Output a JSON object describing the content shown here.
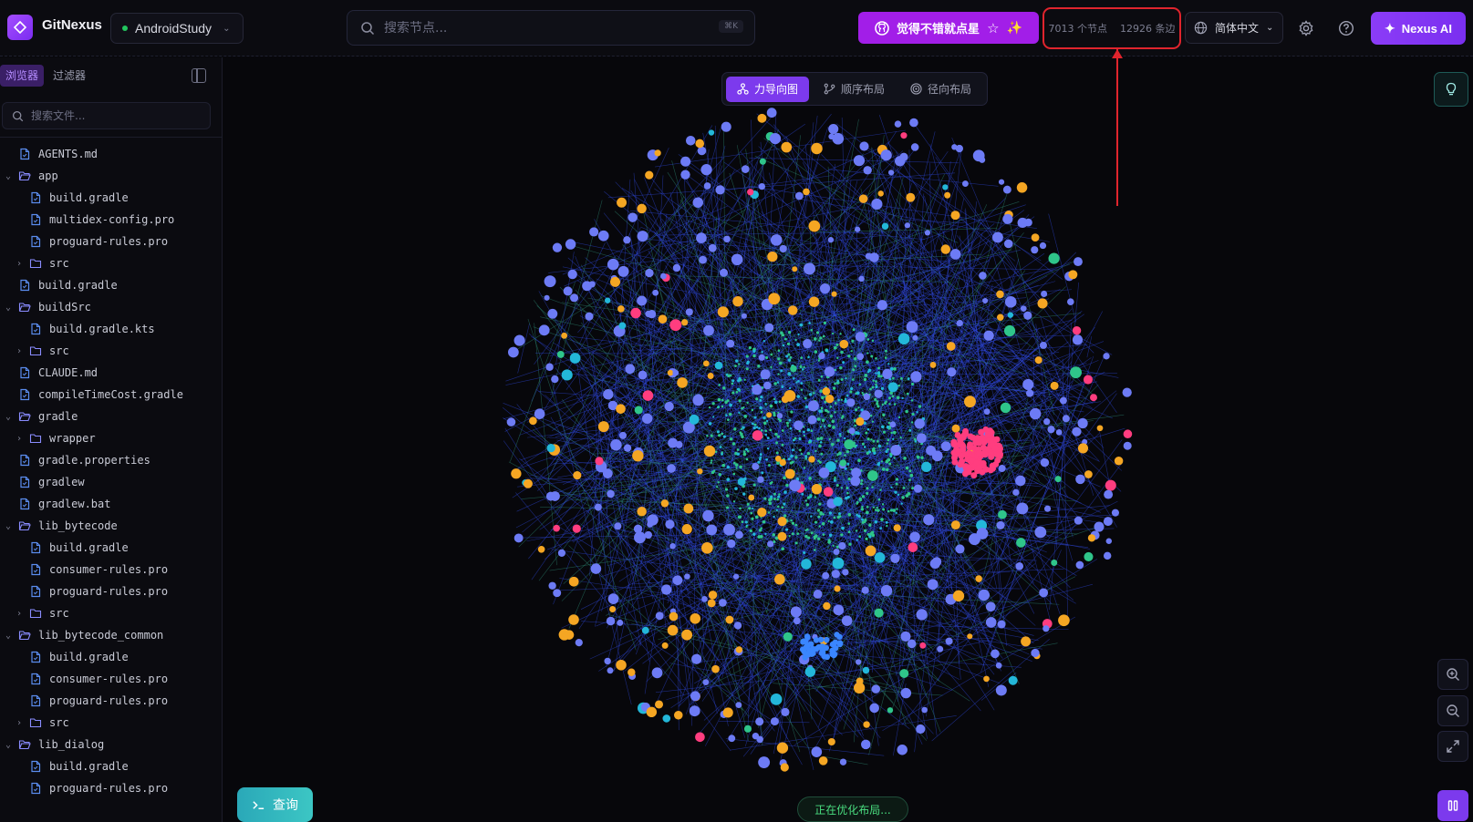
{
  "header": {
    "brand": "GitNexus",
    "project": "AndroidStudy",
    "search_placeholder": "搜索节点...",
    "search_shortcut": "⌘K",
    "star_label": "觉得不错就点星",
    "nodes_count": "7013 个节点",
    "edges_count": "12926 条边",
    "language": "简体中文",
    "nexus_ai": "Nexus AI"
  },
  "sidebar": {
    "tabs": [
      "浏览器",
      "过滤器"
    ],
    "file_search_placeholder": "搜索文件...",
    "tree": [
      {
        "name": "AGENTS.md",
        "type": "file",
        "depth": 0
      },
      {
        "name": "app",
        "type": "folder",
        "depth": 0,
        "open": true
      },
      {
        "name": "build.gradle",
        "type": "file",
        "depth": 1
      },
      {
        "name": "multidex-config.pro",
        "type": "file",
        "depth": 1
      },
      {
        "name": "proguard-rules.pro",
        "type": "file",
        "depth": 1
      },
      {
        "name": "src",
        "type": "folder",
        "depth": 1,
        "open": false
      },
      {
        "name": "build.gradle",
        "type": "file",
        "depth": 0
      },
      {
        "name": "buildSrc",
        "type": "folder",
        "depth": 0,
        "open": true
      },
      {
        "name": "build.gradle.kts",
        "type": "file",
        "depth": 1
      },
      {
        "name": "src",
        "type": "folder",
        "depth": 1,
        "open": false
      },
      {
        "name": "CLAUDE.md",
        "type": "file",
        "depth": 0
      },
      {
        "name": "compileTimeCost.gradle",
        "type": "file",
        "depth": 0
      },
      {
        "name": "gradle",
        "type": "folder",
        "depth": 0,
        "open": true
      },
      {
        "name": "wrapper",
        "type": "folder",
        "depth": 1,
        "open": false
      },
      {
        "name": "gradle.properties",
        "type": "file",
        "depth": 0
      },
      {
        "name": "gradlew",
        "type": "file",
        "depth": 0
      },
      {
        "name": "gradlew.bat",
        "type": "file",
        "depth": 0
      },
      {
        "name": "lib_bytecode",
        "type": "folder",
        "depth": 0,
        "open": true
      },
      {
        "name": "build.gradle",
        "type": "file",
        "depth": 1
      },
      {
        "name": "consumer-rules.pro",
        "type": "file",
        "depth": 1
      },
      {
        "name": "proguard-rules.pro",
        "type": "file",
        "depth": 1
      },
      {
        "name": "src",
        "type": "folder",
        "depth": 1,
        "open": false
      },
      {
        "name": "lib_bytecode_common",
        "type": "folder",
        "depth": 0,
        "open": true
      },
      {
        "name": "build.gradle",
        "type": "file",
        "depth": 1
      },
      {
        "name": "consumer-rules.pro",
        "type": "file",
        "depth": 1
      },
      {
        "name": "proguard-rules.pro",
        "type": "file",
        "depth": 1
      },
      {
        "name": "src",
        "type": "folder",
        "depth": 1,
        "open": false
      },
      {
        "name": "lib_dialog",
        "type": "folder",
        "depth": 0,
        "open": true
      },
      {
        "name": "build.gradle",
        "type": "file",
        "depth": 1
      },
      {
        "name": "proguard-rules.pro",
        "type": "file",
        "depth": 1
      }
    ]
  },
  "canvas": {
    "layouts": [
      "力导向图",
      "顺序布局",
      "径向布局"
    ],
    "active_layout": "力导向图",
    "query_label": "查询",
    "status": "正在优化布局..."
  },
  "colors": {
    "accent": "#7c3aed",
    "star": "#a21ee8",
    "highlight": "#e0242d",
    "node_blue": "#3f57f0",
    "node_orange": "#f5a623",
    "node_pink": "#ff3d7f",
    "node_green": "#2fc58a",
    "node_cyan": "#23b7d9",
    "edge": "#3049e0"
  }
}
